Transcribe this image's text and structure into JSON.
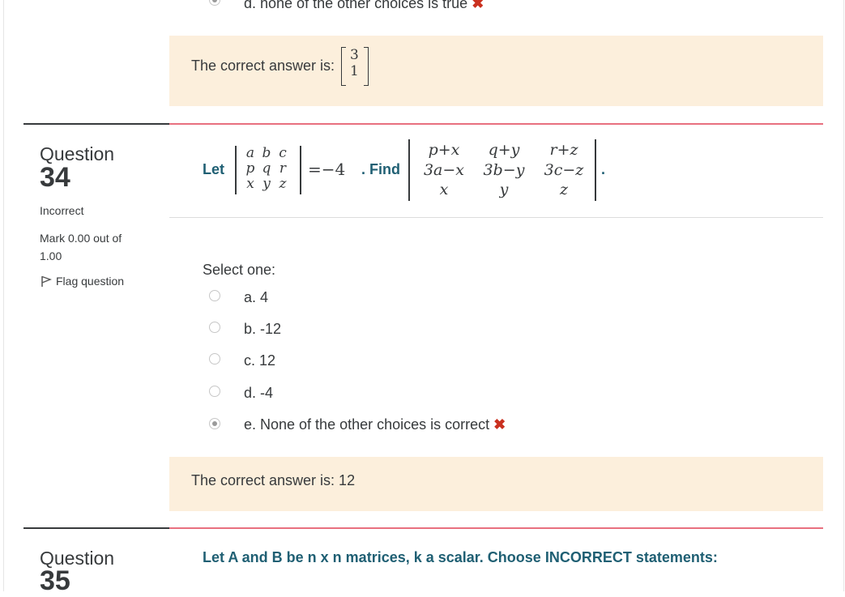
{
  "prev_question": {
    "options": [
      {
        "label": "d. none of the other choices is true",
        "checked": true,
        "mark": "✖"
      }
    ],
    "feedback_label": "The correct answer is:",
    "feedback_matrix": [
      "3",
      "1"
    ]
  },
  "q34": {
    "word": "Question",
    "number": "34",
    "state": "Incorrect",
    "mark": "Mark 0.00 out of 1.00",
    "flag_label": "Flag question",
    "text_let": "Let",
    "det1": [
      [
        "a",
        "b",
        "c"
      ],
      [
        "p",
        "q",
        "r"
      ],
      [
        "x",
        "y",
        "z"
      ]
    ],
    "equals": "=−4",
    "text_find": ". Find",
    "det2": [
      [
        "p+x",
        "q+y",
        "r+z"
      ],
      [
        "3a−x",
        "3b−y",
        "3c−z"
      ],
      [
        "x",
        "y",
        "z"
      ]
    ],
    "period": ".",
    "select_one": "Select one:",
    "options": [
      {
        "label": "a. 4",
        "checked": false
      },
      {
        "label": "b. -12",
        "checked": false
      },
      {
        "label": "c. 12",
        "checked": false
      },
      {
        "label": "d. -4",
        "checked": false
      },
      {
        "label": "e. None of the other choices is correct",
        "checked": true,
        "mark": "✖"
      }
    ],
    "feedback": "The correct answer is: 12"
  },
  "q35": {
    "word": "Question",
    "number": "35",
    "text": "Let A and B be n x n matrices, k a scalar. Choose INCORRECT statements:"
  },
  "colors": {
    "accent_text": "#1f5f73",
    "feedback_bg": "#fcefdc",
    "content_rule": "#e8707f",
    "incorrect": "#ca3120"
  }
}
